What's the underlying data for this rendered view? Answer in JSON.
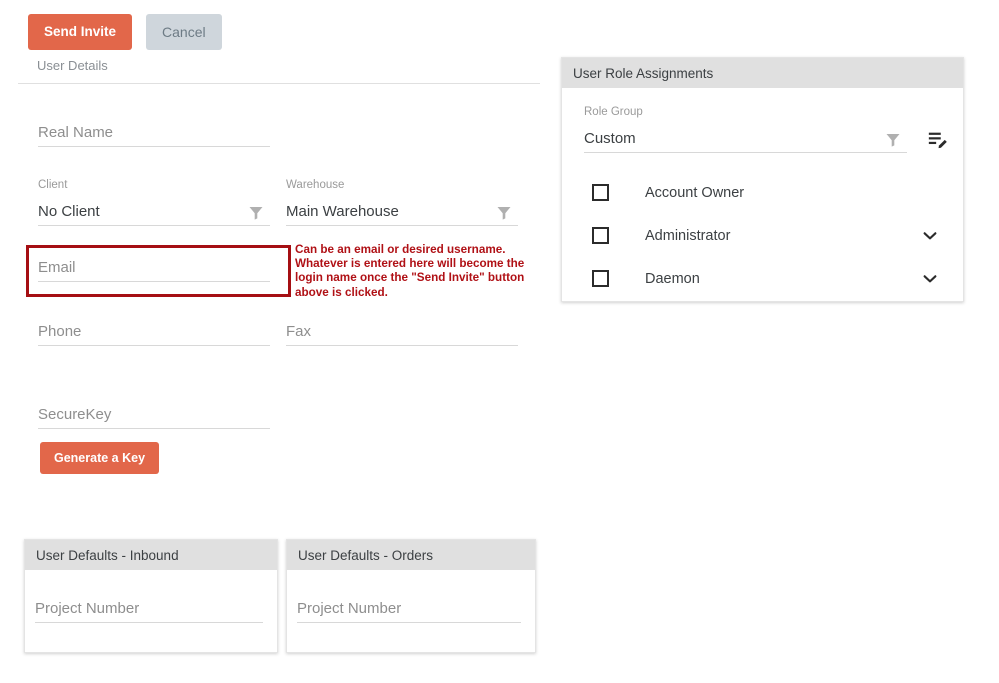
{
  "toolbar": {
    "send_invite_label": "Send Invite",
    "cancel_label": "Cancel"
  },
  "tabs": {
    "user_details_label": "User Details"
  },
  "form": {
    "real_name": {
      "label": "",
      "placeholder": "Real Name",
      "value": ""
    },
    "client": {
      "label": "Client",
      "value": "No Client",
      "icon": "filter-funnel-icon"
    },
    "warehouse": {
      "label": "Warehouse",
      "value": "Main Warehouse",
      "icon": "filter-funnel-icon"
    },
    "email": {
      "label": "",
      "placeholder": "Email",
      "value": ""
    },
    "phone": {
      "label": "",
      "placeholder": "Phone",
      "value": ""
    },
    "fax": {
      "label": "",
      "placeholder": "Fax",
      "value": ""
    },
    "securekey": {
      "label": "",
      "placeholder": "SecureKey",
      "value": ""
    },
    "generate_key_label": "Generate a Key"
  },
  "annotation": {
    "text": "Can be an email or desired username. Whatever is entered here will become the login name once the \"Send Invite\" button above is clicked.",
    "color": "#b01116",
    "highlight_border_color": "#a50f13"
  },
  "roles_panel": {
    "title": "User Role Assignments",
    "role_group": {
      "label": "Role Group",
      "value": "Custom",
      "filter_icon": "filter-funnel-icon",
      "edit_icon": "list-edit-icon"
    },
    "roles": [
      {
        "name": "Account Owner",
        "checked": false,
        "expandable": false
      },
      {
        "name": "Administrator",
        "checked": false,
        "expandable": true
      },
      {
        "name": "Daemon",
        "checked": false,
        "expandable": true
      }
    ]
  },
  "defaults_inbound": {
    "title": "User Defaults - Inbound",
    "project_number": {
      "placeholder": "Project Number",
      "value": ""
    }
  },
  "defaults_orders": {
    "title": "User Defaults - Orders",
    "project_number": {
      "placeholder": "Project Number",
      "value": ""
    }
  },
  "colors": {
    "primary_button": "#e2674a",
    "secondary_button": "#cfd6dc",
    "card_header": "#e0e0e0",
    "annotation_red": "#b01116"
  }
}
